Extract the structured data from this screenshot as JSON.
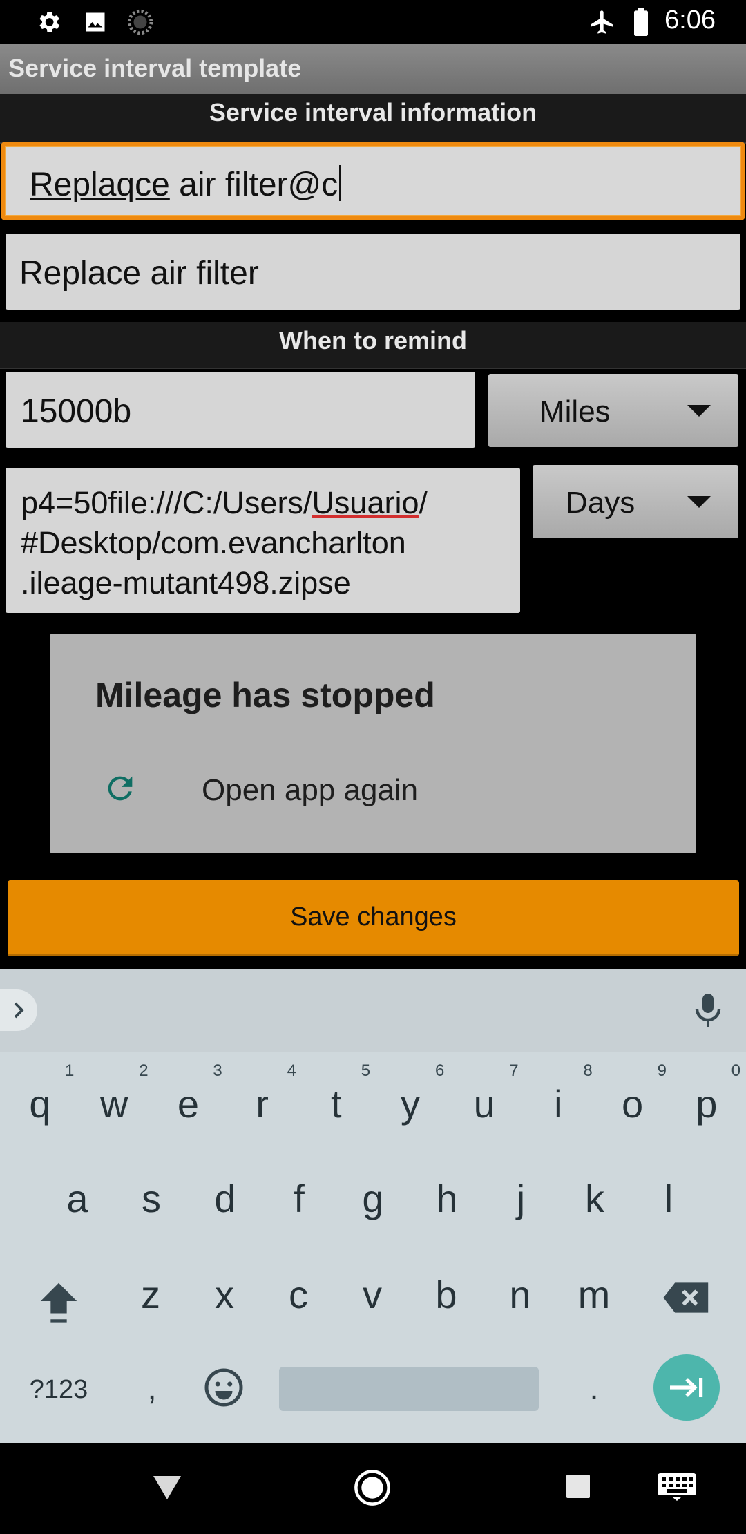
{
  "status_bar": {
    "time": "6:06",
    "left_icons": [
      "gear-icon",
      "image-icon",
      "spinner-icon"
    ],
    "right_icons": [
      "airplane-icon",
      "battery-icon"
    ]
  },
  "app": {
    "title": "Service interval template"
  },
  "sections": {
    "info_header": "Service interval information",
    "remind_header": "When to remind"
  },
  "fields": {
    "name_value": "Replaqce air filter@c",
    "name_underlined_word": "Replaqce",
    "name_rest": " air filter@c",
    "description_value": "Replace air filter",
    "distance_value": "15000b",
    "distance_unit": "Miles",
    "time_value_lines": [
      "p4=50file:///C:/Users/Usuario/",
      "#Desktop/com.evancharlton",
      ".ileage-mutant498.zipse"
    ],
    "time_unit": "Days"
  },
  "dialog": {
    "title": "Mileage has stopped",
    "action_label": "Open app again",
    "action_icon": "refresh-icon",
    "accent_color": "#0f6e63"
  },
  "save_button": {
    "label": "Save changes",
    "color": "#e68a00"
  },
  "keyboard": {
    "row1": [
      "q",
      "w",
      "e",
      "r",
      "t",
      "y",
      "u",
      "i",
      "o",
      "p"
    ],
    "row1_hints": [
      "1",
      "2",
      "3",
      "4",
      "5",
      "6",
      "7",
      "8",
      "9",
      "0"
    ],
    "row2": [
      "a",
      "s",
      "d",
      "f",
      "g",
      "h",
      "j",
      "k",
      "l"
    ],
    "row3": [
      "z",
      "x",
      "c",
      "v",
      "b",
      "n",
      "m"
    ],
    "symbols_label": "?123",
    "comma": ",",
    "period": ".",
    "enter_color": "#4db6ac"
  },
  "nav_bar": {
    "buttons": [
      "back-icon",
      "home-icon",
      "recents-icon",
      "keyboard-icon"
    ]
  }
}
